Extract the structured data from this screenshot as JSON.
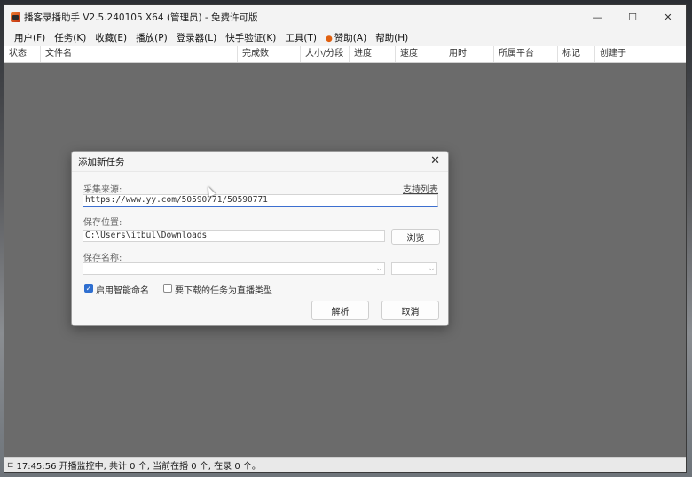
{
  "window": {
    "title": "播客录播助手 V2.5.240105 X64 (管理员) - 免费许可版",
    "controls": {
      "minimize": "—",
      "maximize": "☐",
      "close": "✕"
    }
  },
  "menu": [
    {
      "label": "用户(F)"
    },
    {
      "label": "任务(K)"
    },
    {
      "label": "收藏(E)"
    },
    {
      "label": "播放(P)"
    },
    {
      "label": "登录器(L)"
    },
    {
      "label": "快手验证(K)"
    },
    {
      "label": "工具(T)"
    },
    {
      "label": "赞助(A)"
    },
    {
      "label": "帮助(H)"
    }
  ],
  "table": {
    "columns": [
      "状态",
      "文件名",
      "完成数",
      "大小/分段",
      "进度",
      "速度",
      "用时",
      "所属平台",
      "标记",
      "创建于"
    ]
  },
  "status": {
    "text": "17:45:56 开播监控中, 共计 0 个, 当前在播 0 个, 在录 0 个。"
  },
  "dialog": {
    "title": "添加新任务",
    "close": "✕",
    "source_label": "采集来源:",
    "support_link": "支持列表",
    "source_value": "https://www.yy.com/50590771/50590771",
    "save_location_label": "保存位置:",
    "save_location_value": "C:\\Users\\itbul\\Downloads",
    "browse_button": "浏览",
    "save_name_label": "保存名称:",
    "save_name_value": "",
    "format_value": "",
    "smart_naming_label": "启用智能命名",
    "smart_naming_checked": true,
    "live_type_label": "要下载的任务为直播类型",
    "live_type_checked": false,
    "parse_button": "解析",
    "cancel_button": "取消"
  },
  "colors": {
    "accent": "#2f6fd0",
    "sponsor_dot": "#e06010",
    "workspace": "#6b6b6b"
  }
}
